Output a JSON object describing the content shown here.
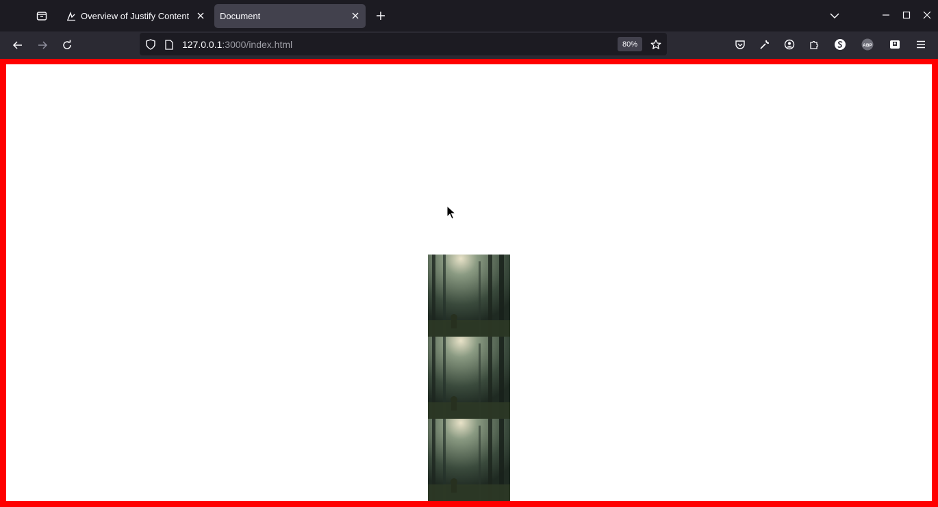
{
  "tabs": [
    {
      "title": "Overview of Justify Content",
      "active": false
    },
    {
      "title": "Document",
      "active": true
    }
  ],
  "nav": {
    "url_host": "127.0.0.1",
    "url_rest": ":3000/index.html",
    "zoom": "80%"
  },
  "toolbar_icons": [
    "pocket-icon",
    "wrench-icon",
    "account-icon",
    "extensions-icon",
    "sync-icon",
    "abp-icon",
    "extension-icon",
    "menu-icon"
  ],
  "page": {
    "border_color": "#ff0000",
    "background": "#ffffff",
    "images": [
      {
        "alt": "forest sunlight photo"
      },
      {
        "alt": "forest sunlight photo"
      },
      {
        "alt": "forest sunlight photo"
      }
    ]
  }
}
